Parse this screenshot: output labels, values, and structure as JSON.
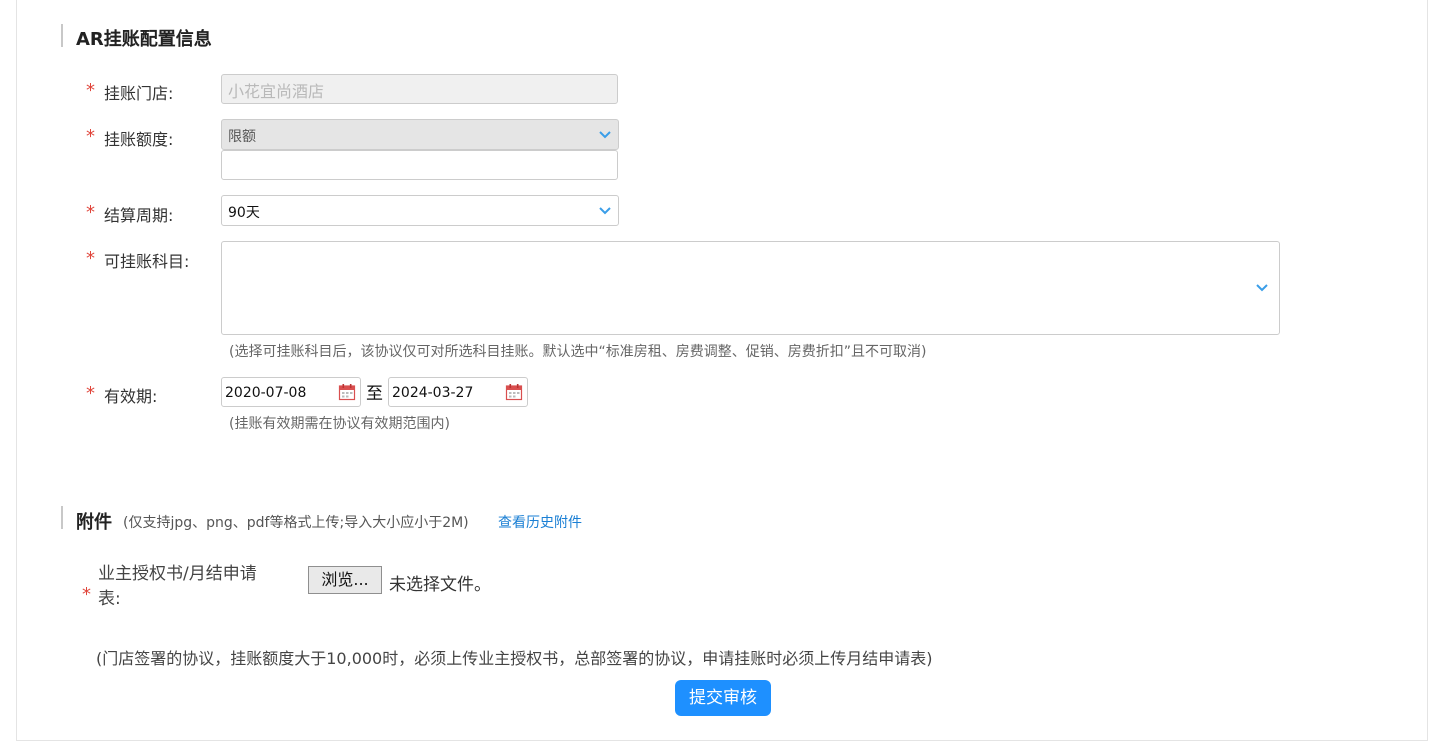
{
  "section_ar": {
    "title": "AR挂账配置信息"
  },
  "form": {
    "required_mark": "*",
    "store": {
      "label": "挂账门店:",
      "value": "小花宜尚酒店"
    },
    "limit": {
      "label": "挂账额度:",
      "selected": "限额",
      "amount": ""
    },
    "cycle": {
      "label": "结算周期:",
      "selected": "90天"
    },
    "subjects": {
      "label": "可挂账科目:",
      "hint": "(选择可挂账科目后，该协议仅可对所选科目挂账。默认选中“标准房租、房费调整、促销、房费折扣”且不可取消)"
    },
    "validity": {
      "label": "有效期:",
      "start": "2020-07-08",
      "separator": "至",
      "end": "2024-03-27",
      "hint": "(挂账有效期需在协议有效期范围内)"
    }
  },
  "section_attach": {
    "title": "附件",
    "note": "(仅支持jpg、png、pdf等格式上传;导入大小应小于2M)",
    "history_link": "查看历史附件"
  },
  "upload": {
    "label_line1": "业主授权书/月结申请",
    "label_line2": "表:",
    "browse_label": "浏览...",
    "no_file": "未选择文件。",
    "note": "(门店签署的协议，挂账额度大于10,000时，必须上传业主授权书，总部签署的协议，申请挂账时必须上传月结申请表)"
  },
  "submit_label": "提交审核",
  "colors": {
    "accent": "#1e90ff",
    "required": "#e0443a",
    "link": "#1a7fd4",
    "chevron": "#3a9ee8",
    "calendar": "#d94f4f"
  }
}
